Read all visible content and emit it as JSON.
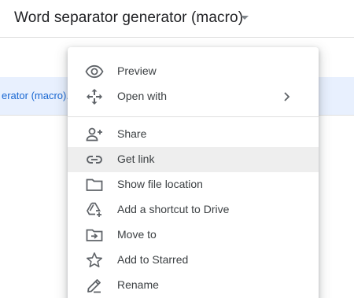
{
  "header": {
    "title": "Word separator generator (macro)",
    "caret_icon": "arrow-drop-down-icon"
  },
  "file_list": {
    "selected_file_name": "erator (macro).x"
  },
  "context_menu": {
    "items": [
      {
        "label": "Preview",
        "icon": "eye-icon"
      },
      {
        "label": "Open with",
        "icon": "move-arrows-icon",
        "has_submenu": true
      },
      {
        "label": "Share",
        "icon": "person-add-icon"
      },
      {
        "label": "Get link",
        "icon": "link-icon",
        "highlighted": true
      },
      {
        "label": "Show file location",
        "icon": "folder-icon"
      },
      {
        "label": "Add a shortcut to Drive",
        "icon": "drive-shortcut-icon"
      },
      {
        "label": "Move to",
        "icon": "move-to-folder-icon"
      },
      {
        "label": "Add to Starred",
        "icon": "star-outline-icon"
      },
      {
        "label": "Rename",
        "icon": "pencil-icon"
      }
    ]
  },
  "colors": {
    "selected_row_bg": "#e8f0fe",
    "file_name_text": "#1967d2",
    "highlight_bg": "#eeeeee",
    "icon_gray": "#5f6368"
  }
}
